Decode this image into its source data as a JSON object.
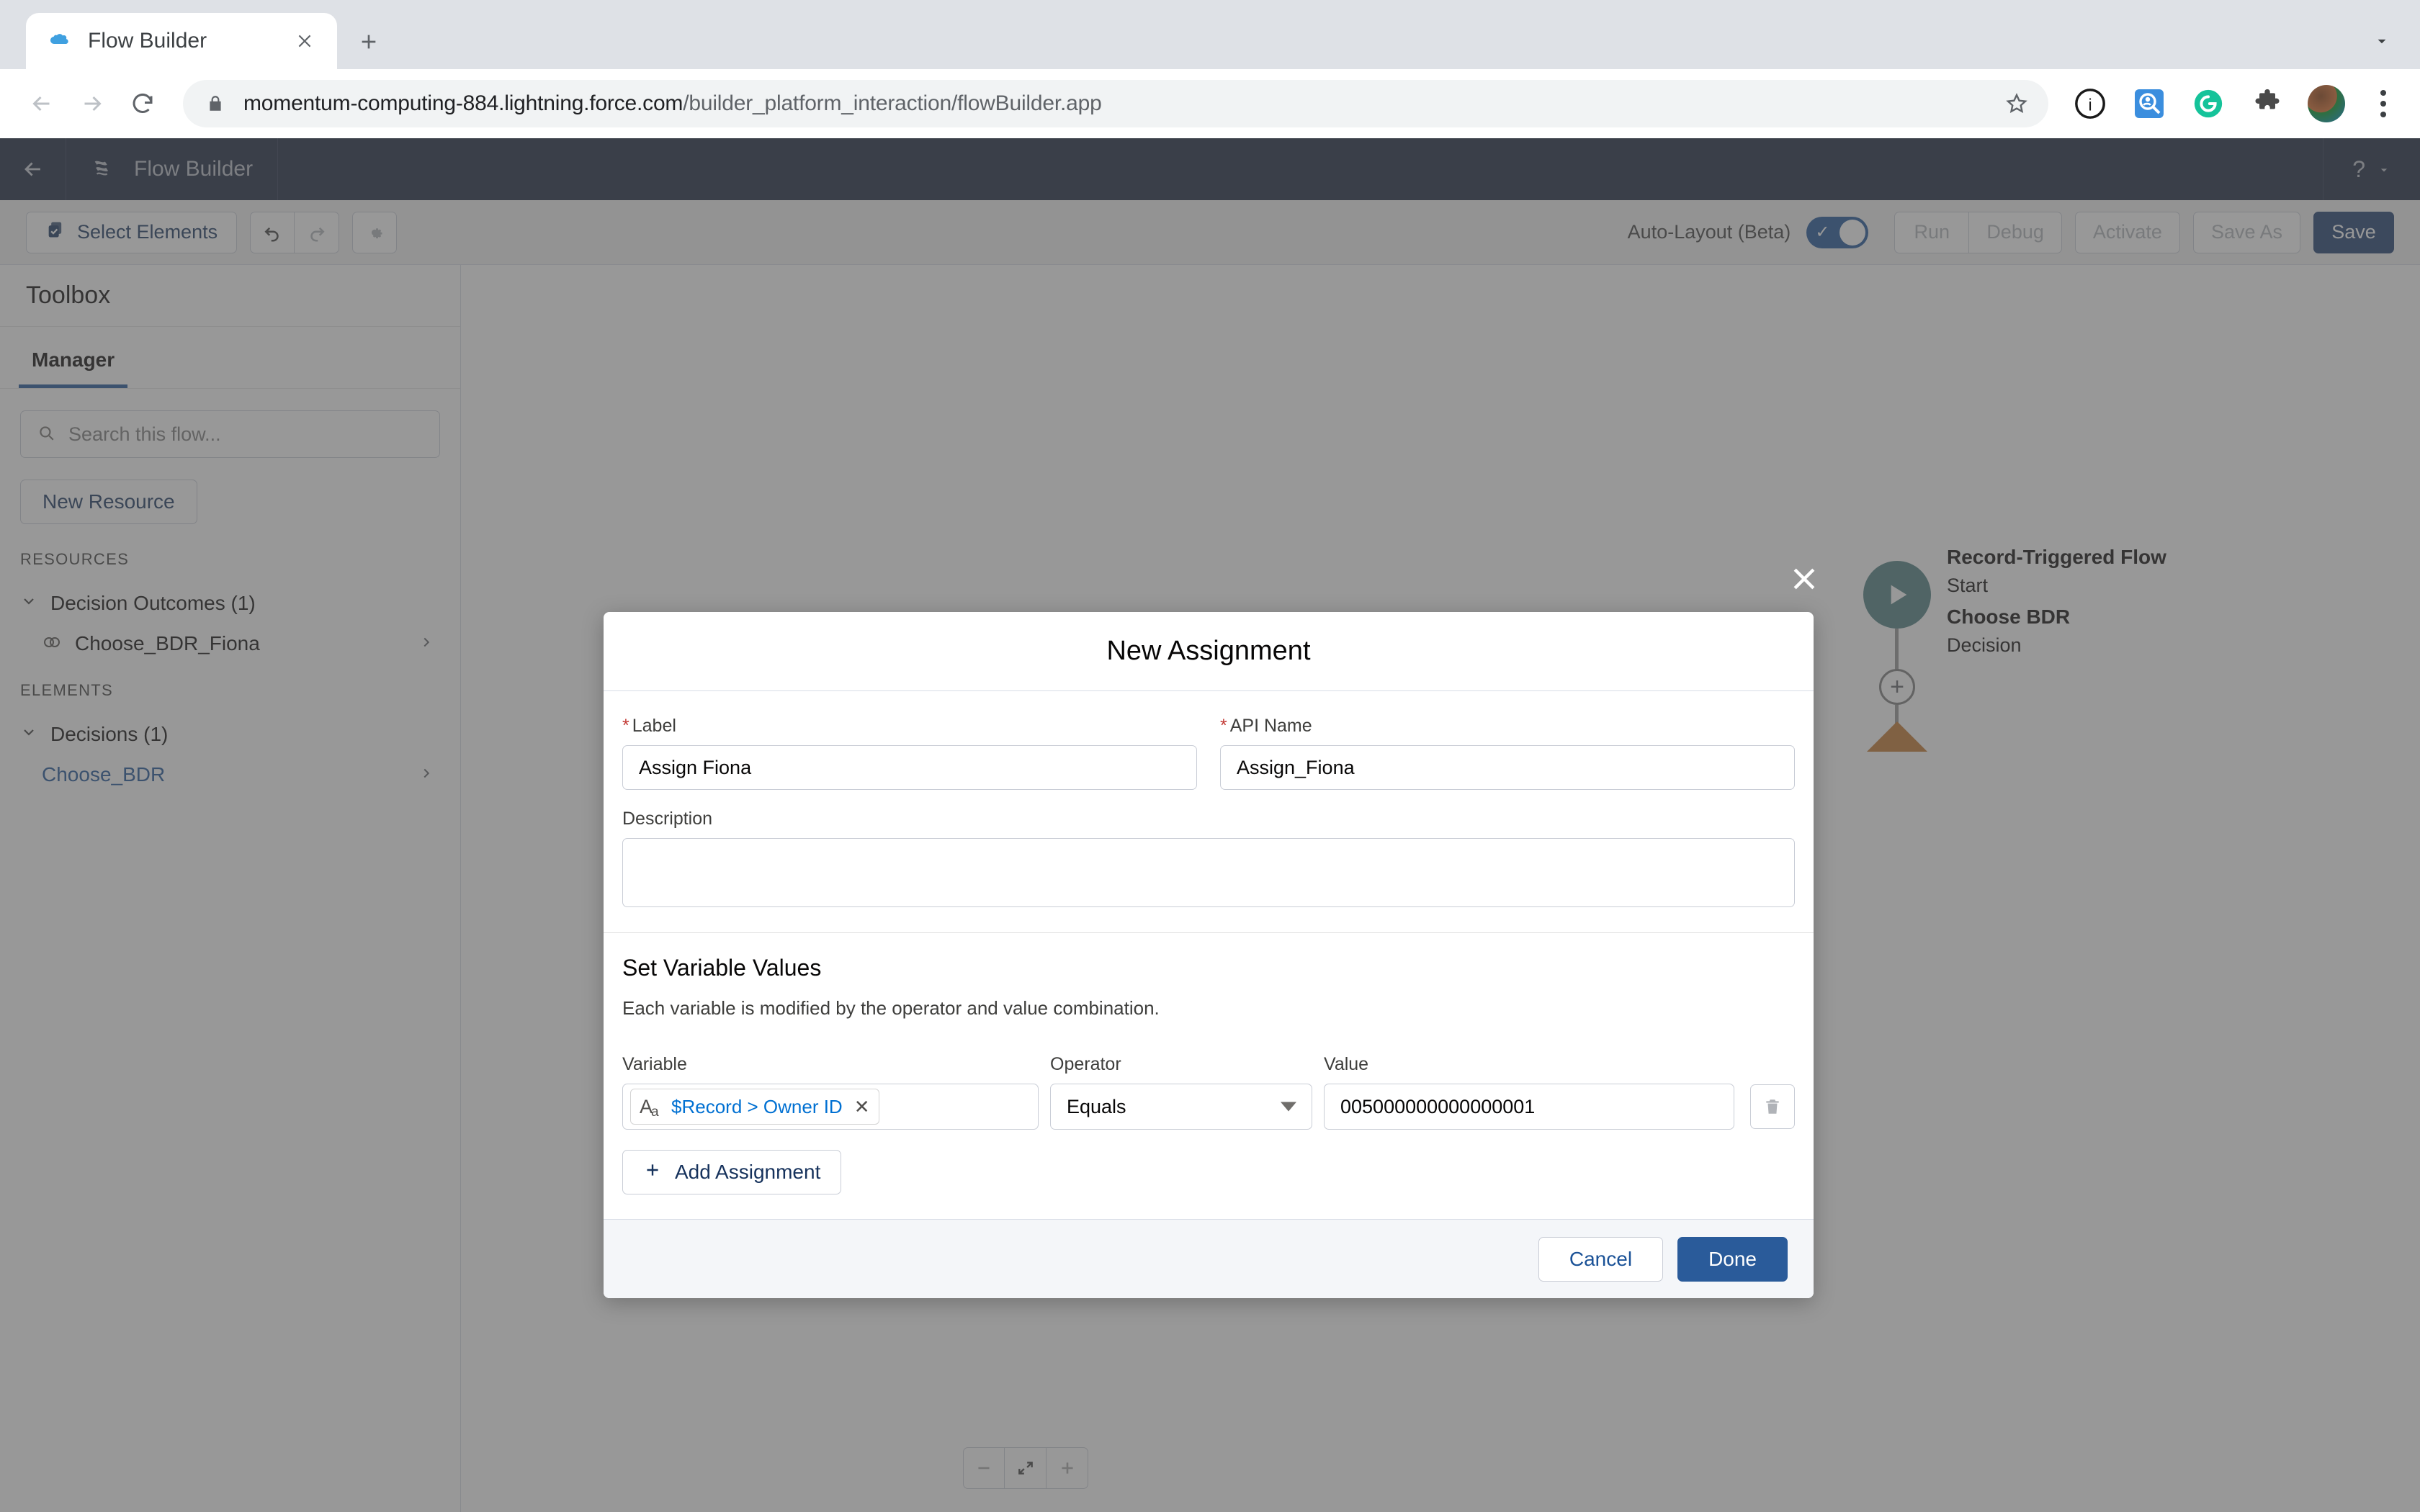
{
  "browser": {
    "tab": {
      "title": "Flow Builder",
      "favicon_icon": "salesforce-cloud-icon",
      "close_icon": "close-icon"
    },
    "new_tab_icon": "plus-icon",
    "collapse_icon": "chevron-down-icon",
    "nav": {
      "back_icon": "arrow-left-icon",
      "forward_icon": "arrow-right-icon",
      "reload_icon": "reload-icon"
    },
    "omnibox": {
      "lock_icon": "lock-icon",
      "url_host": "momentum-computing-884.lightning.force.com",
      "url_path": "/builder_platform_interaction/flowBuilder.app",
      "star_icon": "star-icon"
    },
    "extensions": [
      {
        "name": "info-circle-icon",
        "label": "i"
      },
      {
        "name": "search-person-icon",
        "label": ""
      },
      {
        "name": "grammarly-icon",
        "label": "G"
      },
      {
        "name": "puzzle-piece-icon",
        "label": ""
      }
    ],
    "avatar_name": "profile-avatar",
    "menu_icon": "kebab-menu-icon"
  },
  "app_header": {
    "back_icon": "arrow-left-icon",
    "logo_icon": "flow-builder-logo-icon",
    "title": "Flow Builder",
    "help_icon": "question-mark-icon",
    "help_caret_icon": "caret-down-icon"
  },
  "toolbar": {
    "select_elements_label": "Select Elements",
    "select_elements_icon": "select-elements-icon",
    "undo_icon": "undo-icon",
    "redo_icon": "redo-icon",
    "settings_icon": "gear-icon",
    "autolayout_label": "Auto-Layout (Beta)",
    "autolayout_checked": true,
    "actions": [
      {
        "label": "Run",
        "enabled": false
      },
      {
        "label": "Debug",
        "enabled": false
      },
      {
        "label": "Activate",
        "enabled": false
      },
      {
        "label": "Save As",
        "enabled": false
      }
    ],
    "save_label": "Save"
  },
  "sidebar": {
    "title": "Toolbox",
    "tab_label": "Manager",
    "search_placeholder": "Search this flow...",
    "search_icon": "search-icon",
    "new_resource_label": "New Resource",
    "resources_header": "RESOURCES",
    "elements_header": "ELEMENTS",
    "resources_group": {
      "label": "Decision Outcomes (1)",
      "chevron_icon": "chevron-down-icon"
    },
    "resources_items": [
      {
        "label": "Choose_BDR_Fiona",
        "icon": "outcome-icon",
        "chevron_icon": "chevron-right-icon"
      }
    ],
    "elements_group": {
      "label": "Decisions (1)",
      "chevron_icon": "chevron-down-icon"
    },
    "elements_items": [
      {
        "label": "Choose_BDR",
        "chevron_icon": "chevron-right-icon"
      }
    ]
  },
  "canvas": {
    "start_node": {
      "title": "Record-Triggered Flow",
      "subtitle": "Start",
      "icon": "play-icon",
      "color": "#4b7e80"
    },
    "decision_node": {
      "title": "Choose BDR",
      "subtitle": "Decision",
      "color": "#c2762c"
    },
    "add_connector_icon": "plus-circle-icon",
    "zoom_controls": [
      {
        "name": "zoom-out-button",
        "icon": "minus-icon"
      },
      {
        "name": "zoom-fit-button",
        "icon": "fit-to-view-icon"
      },
      {
        "name": "zoom-in-button",
        "icon": "plus-icon"
      }
    ]
  },
  "modal": {
    "title": "New Assignment",
    "close_icon": "close-icon",
    "label_field": {
      "label": "Label",
      "required": true,
      "value": "Assign Fiona"
    },
    "api_name_field": {
      "label": "API Name",
      "required": true,
      "value": "Assign_Fiona"
    },
    "description_field": {
      "label": "Description",
      "value": "",
      "placeholder": ""
    },
    "section": {
      "title": "Set Variable Values",
      "subtitle": "Each variable is modified by the operator and value combination."
    },
    "columns": {
      "variable": "Variable",
      "operator": "Operator",
      "value": "Value"
    },
    "assignment_row": {
      "variable_pill_icon": "text-format-icon",
      "variable_pill_text": "$Record > Owner ID",
      "variable_pill_remove_icon": "close-icon",
      "operator": "Equals",
      "value": "005000000000000001",
      "delete_icon": "trash-icon"
    },
    "add_assignment_label": "Add Assignment",
    "add_assignment_icon": "plus-icon",
    "cancel_label": "Cancel",
    "done_label": "Done"
  }
}
